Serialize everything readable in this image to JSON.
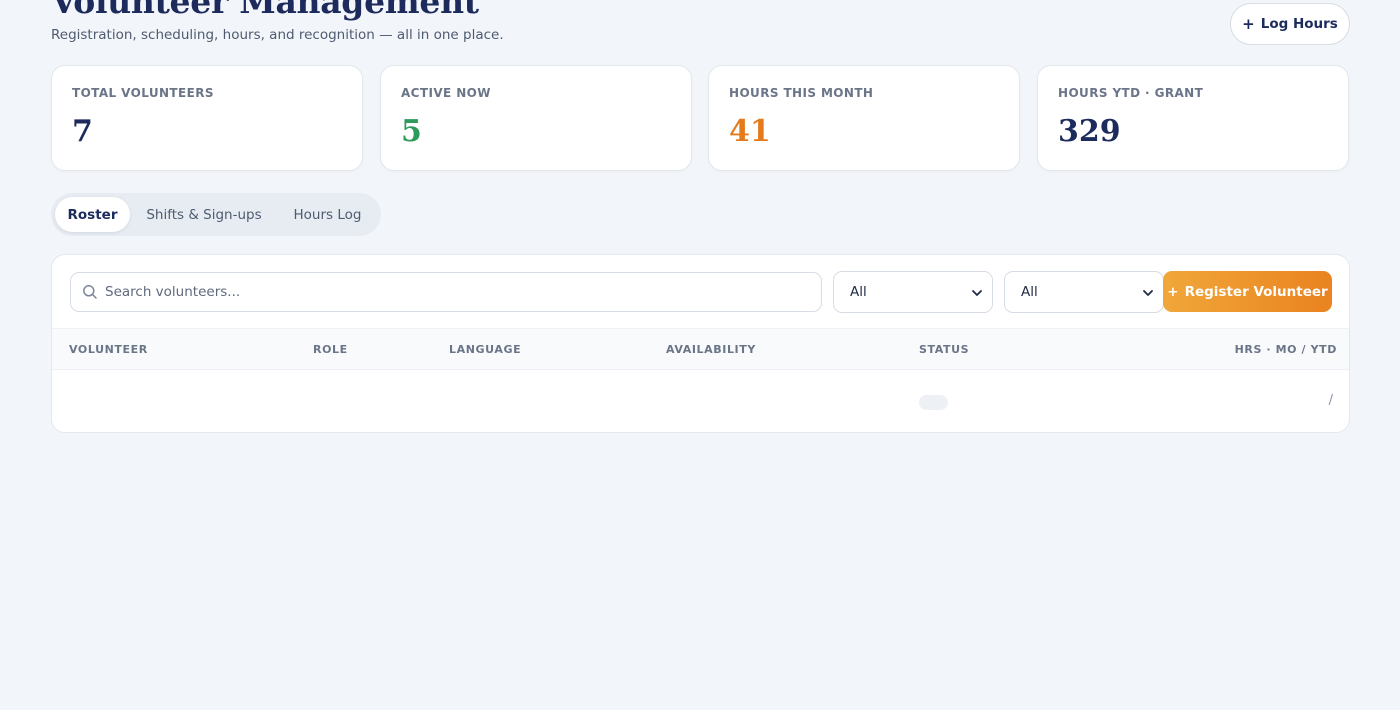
{
  "header": {
    "title": "Volunteer Management",
    "subtitle": "Registration, scheduling, hours, and recognition — all in one place.",
    "log_hours_label": "Log Hours"
  },
  "stats": [
    {
      "label": "TOTAL VOLUNTEERS",
      "value": "7",
      "color": "#1c2b5c"
    },
    {
      "label": "ACTIVE NOW",
      "value": "5",
      "color": "#2e9a5b"
    },
    {
      "label": "HOURS THIS MONTH",
      "value": "41",
      "color": "#e47a1c"
    },
    {
      "label": "HOURS YTD · GRANT",
      "value": "329",
      "color": "#1c2b5c"
    }
  ],
  "tabs": [
    {
      "label": "Roster",
      "active": true
    },
    {
      "label": "Shifts & Sign-ups",
      "active": false
    },
    {
      "label": "Hours Log",
      "active": false
    }
  ],
  "toolbar": {
    "search_placeholder": "Search volunteers...",
    "filter_1_value": "All",
    "filter_2_value": "All",
    "register_label": "Register Volunteer"
  },
  "table": {
    "columns": [
      "VOLUNTEER",
      "ROLE",
      "LANGUAGE",
      "AVAILABILITY",
      "STATUS",
      "HRS · MO / YTD"
    ],
    "rows": [
      {
        "volunteer": "",
        "role": "",
        "language": "",
        "availability": "",
        "status": "",
        "hours": "/"
      }
    ]
  },
  "icons": {
    "search": "search-icon",
    "plus": "plus-icon",
    "chevron": "chevron-down-icon"
  },
  "colors": {
    "accent_orange": "#ea8320",
    "navy": "#1c2b5c",
    "green": "#2e9a5b"
  }
}
